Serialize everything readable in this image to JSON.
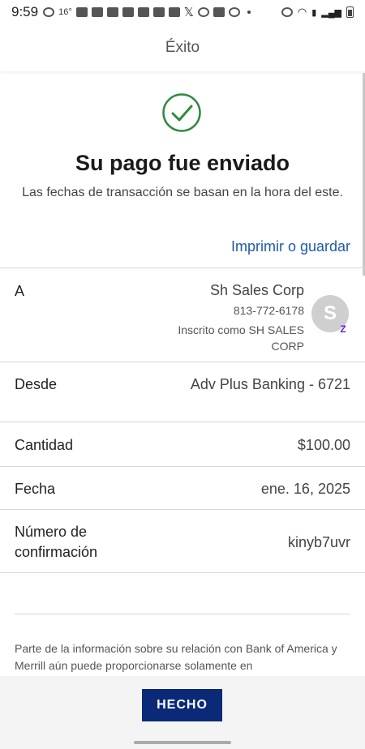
{
  "status_bar": {
    "time": "9:59",
    "temp": "16°"
  },
  "header": {
    "title": "Éxito"
  },
  "success": {
    "icon": "checkmark-circle-icon",
    "title": "Su pago fue enviado",
    "subtitle": "Las fechas de transacción se basan en la hora del este.",
    "print_link": "Imprimir o guardar"
  },
  "details": {
    "to": {
      "label": "A",
      "name": "Sh Sales Corp",
      "phone": "813-772-6178",
      "enrolled": "Inscrito como SH SALES CORP",
      "avatar_letter": "S"
    },
    "from": {
      "label": "Desde",
      "value": "Adv Plus Banking - 6721"
    },
    "amount": {
      "label": "Cantidad",
      "value": "$100.00"
    },
    "date": {
      "label": "Fecha",
      "value": "ene. 16, 2025"
    },
    "confirmation": {
      "label": "Número de confirmación",
      "value": "kinyb7uvr"
    }
  },
  "disclaimer": "Parte de la información sobre su relación con Bank of America y Merrill aún puede proporcionarse solamente en",
  "footer": {
    "done_label": "HECHO"
  },
  "colors": {
    "accent": "#1f5aa6",
    "button": "#0a2a78",
    "success_green": "#2e8b3e",
    "zelle": "#6d1ed4"
  }
}
